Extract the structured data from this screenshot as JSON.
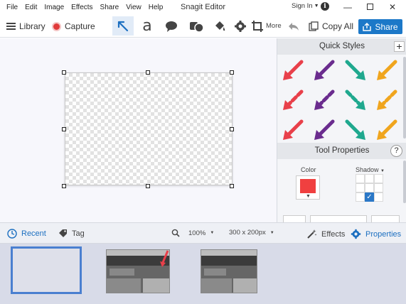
{
  "app_title": "Snagit Editor",
  "menu": [
    "File",
    "Edit",
    "Image",
    "Effects",
    "Share",
    "View",
    "Help"
  ],
  "signin_label": "Sign In",
  "toolbar": {
    "library_label": "Library",
    "capture_label": "Capture",
    "more_label": "More",
    "copy_all_label": "Copy All",
    "share_label": "Share",
    "text_tool_glyph": "a"
  },
  "quick_styles": {
    "title": "Quick Styles",
    "arrow_colors": [
      "#e8404a",
      "#6a2c8e",
      "#1fa88e",
      "#f0a51e"
    ]
  },
  "tool_properties": {
    "title": "Tool Properties",
    "color_label": "Color",
    "shadow_label": "Shadow",
    "color_value": "#f04040"
  },
  "statusbar": {
    "recent_label": "Recent",
    "tag_label": "Tag",
    "zoom_value": "100%",
    "size_value": "300 x 200px",
    "effects_label": "Effects",
    "properties_label": "Properties"
  },
  "colors": {
    "accent": "#1c78c8",
    "capture_dot": "#e03a3a"
  }
}
